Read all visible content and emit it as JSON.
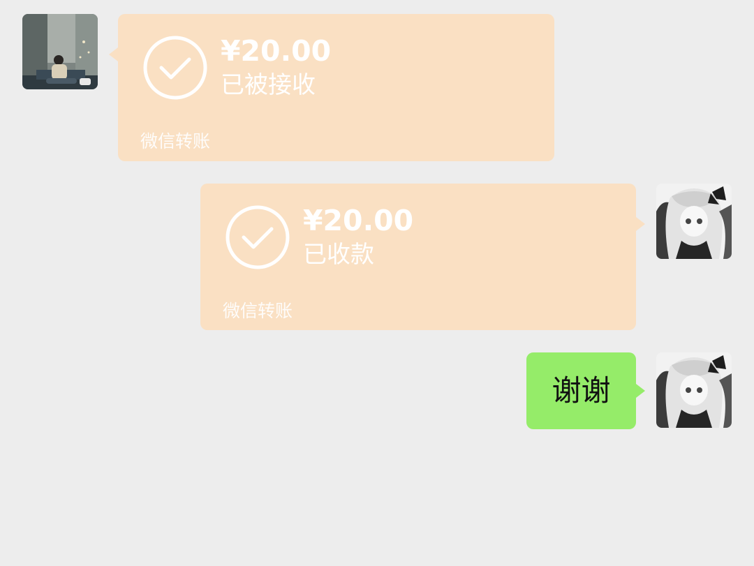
{
  "chat": {
    "messages": [
      {
        "sender": "contact",
        "type": "transfer",
        "amount": "¥20.00",
        "status": "已被接收",
        "source": "微信转账"
      },
      {
        "sender": "me",
        "type": "transfer",
        "amount": "¥20.00",
        "status": "已收款",
        "source": "微信转账"
      },
      {
        "sender": "me",
        "type": "text",
        "text": "谢谢"
      }
    ]
  },
  "colors": {
    "background": "#ededed",
    "transfer_bubble": "#fae0c3",
    "text_bubble": "#95ec69",
    "transfer_text": "#ffffff"
  },
  "icons": {
    "transfer_status": "check-circle-icon"
  }
}
